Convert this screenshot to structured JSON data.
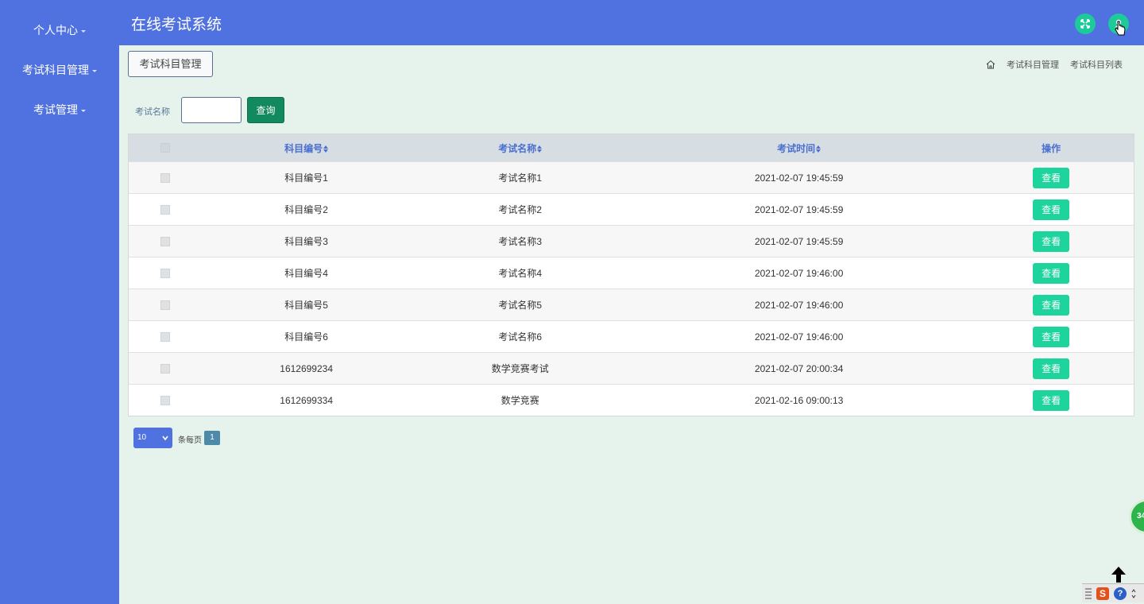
{
  "header": {
    "title": "在线考试系统",
    "fullscreen_icon": "expand-icon",
    "user_icon": "user-icon"
  },
  "sidebar": {
    "items": [
      {
        "label": "个人中心"
      },
      {
        "label": "考试科目管理"
      },
      {
        "label": "考试管理"
      }
    ]
  },
  "module_button": {
    "label": "考试科目管理"
  },
  "breadcrumb": {
    "home_icon": "home-icon",
    "items": [
      "考试科目管理",
      "考试科目列表"
    ]
  },
  "search": {
    "label": "考试名称",
    "value": "",
    "button_label": "查询"
  },
  "table": {
    "columns": [
      "科目编号",
      "考试名称",
      "考试时间",
      "操作"
    ],
    "rows": [
      {
        "code": "科目编号1",
        "name": "考试名称1",
        "time": "2021-02-07 19:45:59",
        "action": "查看"
      },
      {
        "code": "科目编号2",
        "name": "考试名称2",
        "time": "2021-02-07 19:45:59",
        "action": "查看"
      },
      {
        "code": "科目编号3",
        "name": "考试名称3",
        "time": "2021-02-07 19:45:59",
        "action": "查看"
      },
      {
        "code": "科目编号4",
        "name": "考试名称4",
        "time": "2021-02-07 19:46:00",
        "action": "查看"
      },
      {
        "code": "科目编号5",
        "name": "考试名称5",
        "time": "2021-02-07 19:46:00",
        "action": "查看"
      },
      {
        "code": "科目编号6",
        "name": "考试名称6",
        "time": "2021-02-07 19:46:00",
        "action": "查看"
      },
      {
        "code": "1612699234",
        "name": "数学竞赛考试",
        "time": "2021-02-07 20:00:34",
        "action": "查看"
      },
      {
        "code": "1612699334",
        "name": "数学竞赛",
        "time": "2021-02-16 09:00:13",
        "action": "查看"
      }
    ]
  },
  "pagination": {
    "page_size": "10",
    "per_page_label": "条每页",
    "current_page": "1"
  },
  "float_widget": {
    "label": "34"
  },
  "ime": {
    "logo": "S",
    "help": "?"
  },
  "colors": {
    "primary": "#5072e0",
    "accent_green": "#1dd49d",
    "search_green": "#12895e",
    "background": "#e6f2ec"
  }
}
